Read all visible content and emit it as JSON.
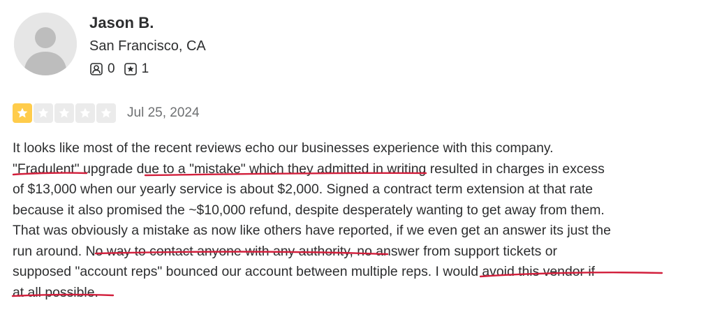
{
  "reviewer": {
    "name": "Jason B.",
    "location": "San Francisco, CA",
    "friends_count": "0",
    "reviews_count": "1"
  },
  "rating": {
    "stars": 1,
    "max": 5,
    "date": "Jul 25, 2024",
    "colors": {
      "filled": "#ffcc4b",
      "empty": "#ebebeb"
    }
  },
  "review": {
    "lines": [
      "It looks like most of the recent reviews echo our businesses experience with this company.",
      "\"Fradulent\" upgrade due to a \"mistake\" which they admitted in writing resulted in charges in excess",
      "of $13,000 when our yearly service is about $2,000. Signed a contract term extension at that rate",
      "because it also promised the ~$10,000 refund, despite desperately wanting to get away from them.",
      "That was obviously a mistake as now like others have reported, if we even get an answer its just the",
      "run around. No way to contact anyone with any authority, no answer from support tickets or",
      "supposed \"account reps\" bounced our account between multiple reps. I would avoid this vendor if",
      "at all possible."
    ]
  },
  "annotation_color": "#d21f3c"
}
